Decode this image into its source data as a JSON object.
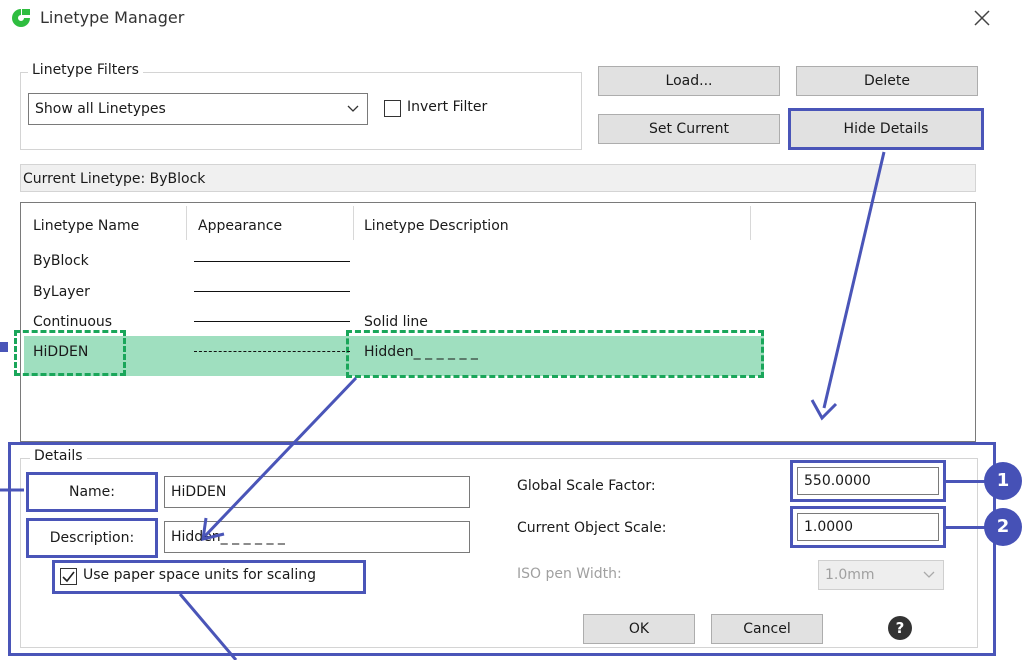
{
  "window": {
    "title": "Linetype Manager"
  },
  "filters": {
    "group_label": "Linetype Filters",
    "dropdown_value": "Show all Linetypes",
    "invert_label": "Invert Filter",
    "invert_checked": false
  },
  "buttons": {
    "load": "Load...",
    "delete": "Delete",
    "set_current": "Set Current",
    "hide_details": "Hide Details",
    "ok": "OK",
    "cancel": "Cancel"
  },
  "current_linetype": "Current Linetype: ByBlock",
  "table": {
    "headers": [
      "Linetype Name",
      "Appearance",
      "Linetype Description"
    ],
    "rows": [
      {
        "name": "ByBlock",
        "description": ""
      },
      {
        "name": "ByLayer",
        "description": ""
      },
      {
        "name": "Continuous",
        "description": "Solid line"
      },
      {
        "name": "HiDDEN",
        "description": "Hidden_ _ _ _ _ _"
      }
    ]
  },
  "details": {
    "group_label": "Details",
    "name_label": "Name:",
    "name_value": "HiDDEN",
    "description_label": "Description:",
    "description_value": "Hidden_ _ _ _ _ _",
    "paper_space_label": "Use paper space units for scaling",
    "paper_space_checked": true,
    "global_scale_label": "Global Scale Factor:",
    "global_scale_value": "550.0000",
    "object_scale_label": "Current Object Scale:",
    "object_scale_value": "1.0000",
    "iso_pen_label": "ISO pen Width:",
    "iso_pen_value": "1.0mm"
  },
  "markers": [
    "1",
    "2"
  ],
  "colors": {
    "highlight": "#4a55b8",
    "selection": "#9fdfbf",
    "dashed": "#1aa65a"
  }
}
